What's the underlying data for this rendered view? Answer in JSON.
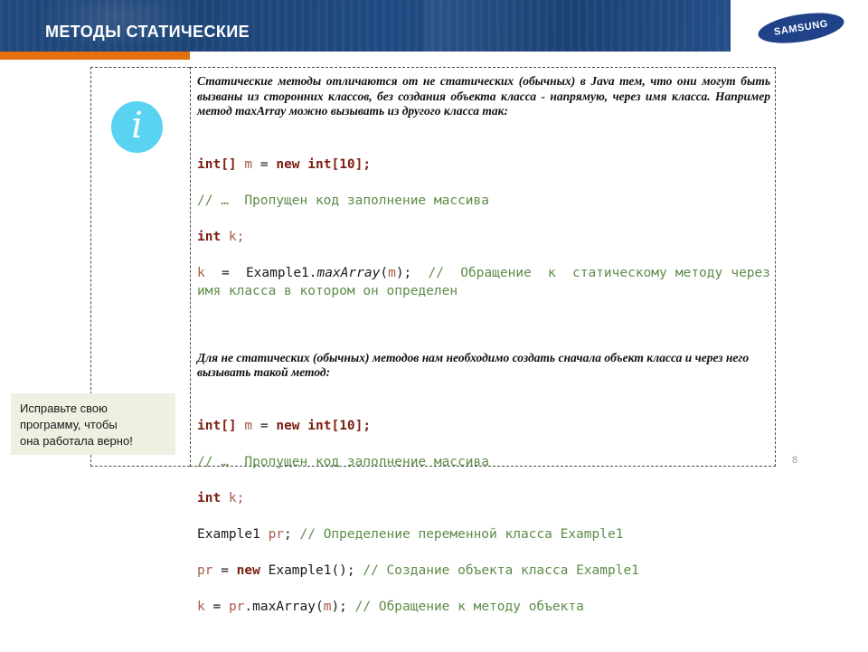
{
  "header": {
    "title": "МЕТОДЫ СТАТИЧЕСКИЕ",
    "band_color": "#1f4a82",
    "accent_bar_color": "#e2700d",
    "logo": {
      "name": "samsung-logo",
      "wordmark": "SAMSUNG",
      "ellipse_color": "#1f4289",
      "text_color": "#ffffff"
    }
  },
  "icon": {
    "name": "info-icon",
    "glyph": "i",
    "circle_color": "#5ad2f2"
  },
  "body": {
    "intro_paragraph": "Статические методы отличаются от не статических (обычных) в Java тем, что они могут быть вызваны из сторонних классов, без создания объекта класса - напрямую, через имя класса. Например метод maxArray можно вызывать из другого класса так:",
    "second_paragraph": "Для не статических (обычных) методов нам необходимо создать сначала объект класса и через него вызывать такой метод:",
    "code_block_1": {
      "line1_kw_int": "int",
      "line1_brackets": "[] ",
      "line1_var_m": "m",
      "line1_eq": " = ",
      "line1_kw_new": "new",
      "line1_kw_int2": " int",
      "line1_tail": "[10];",
      "line2_comment": "// …  Пропущен код заполнение массива",
      "line3_kw_int": "int",
      "line3_var_k": " k",
      "line3_semi": ";",
      "line4_var_k": "k",
      "line4_eq": "  =  ",
      "line4_class": "Example1.",
      "line4_method": "maxArray",
      "line4_paren_open": "(",
      "line4_arg": "m",
      "line4_paren_close": ");",
      "line4_comment": "  //  Обращение  к  статическому методу через имя класса в котором он определен"
    },
    "code_block_2": {
      "line1_kw_int": "int",
      "line1_brackets": "[] ",
      "line1_var_m": "m",
      "line1_eq": " = ",
      "line1_kw_new": "new",
      "line1_kw_int2": " int",
      "line1_tail": "[10];",
      "line2_comment": "// …  Пропущен код заполнение массива",
      "line3_kw_int": "int",
      "line3_var_k": " k",
      "line3_semi": ";",
      "line4_class": "Example1 ",
      "line4_var_pr": "pr",
      "line4_semi": "; ",
      "line4_comment": "// Определение переменной класса Example1",
      "line5_var_pr": "pr",
      "line5_eq": " = ",
      "line5_kw_new": "new",
      "line5_call": " Example1();",
      "line5_comment": " // Создание объекта класса Example1",
      "line6_var_k": "k",
      "line6_eq": " = ",
      "line6_var_pr": "pr",
      "line6_dot_method": ".maxArray(",
      "line6_arg": "m",
      "line6_close": ");",
      "line6_comment": " // Обращение к методу объекта"
    }
  },
  "callout": {
    "name": "correction-callout",
    "background_color": "#eef0e1",
    "line1": "Исправьте свою",
    "line2": "программу, чтобы",
    "line3": "она работала верно!"
  },
  "footer": {
    "page_number": "8"
  }
}
